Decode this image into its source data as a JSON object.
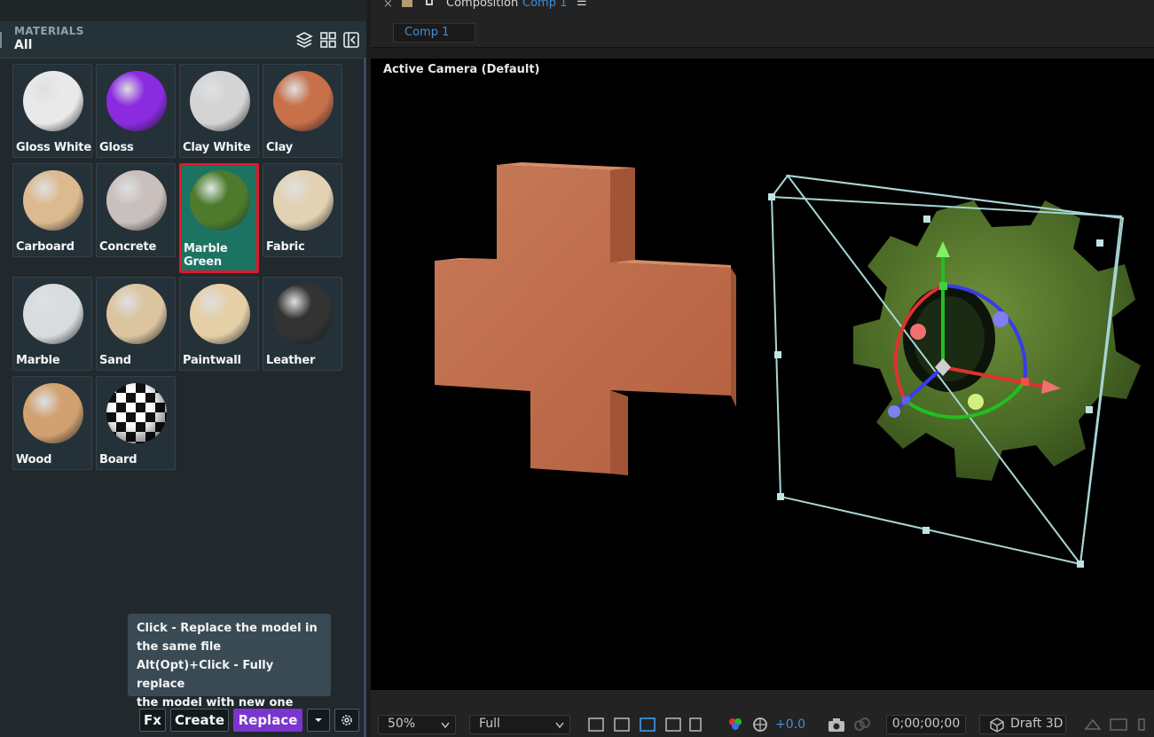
{
  "panel": {
    "title": "MATERIALS",
    "subtitle": "All",
    "icons": [
      "layers-icon",
      "grid-icon",
      "collapse-panel-icon"
    ]
  },
  "materials": [
    {
      "label": "Gloss White",
      "color": "#e9e9e9"
    },
    {
      "label": "Gloss",
      "color": "#8a2be2"
    },
    {
      "label": "Clay White",
      "color": "#d4d4d4"
    },
    {
      "label": "Clay",
      "color": "#c7704a"
    },
    {
      "label": "Carboard",
      "color": "#dcb98e"
    },
    {
      "label": "Concrete",
      "color": "#c9bfbd"
    },
    {
      "label": "Marble Green",
      "color": "#4e7a2c",
      "selected": true
    },
    {
      "label": "Fabric",
      "color": "#e2d2b3"
    },
    {
      "label": "Marble",
      "color": "#d9dcde"
    },
    {
      "label": "Sand",
      "color": "#dcc4a0"
    },
    {
      "label": "Paintwall",
      "color": "#e4cfa6"
    },
    {
      "label": "Leather",
      "color": "#333333"
    },
    {
      "label": "Wood",
      "color": "#d1a170"
    },
    {
      "label": "Board",
      "color": "#ffffff"
    }
  ],
  "tooltip": {
    "line1": "Click - Replace the model in",
    "line2": "the same file",
    "line3": "Alt(Opt)+Click - Fully replace",
    "line4": "the model with new one"
  },
  "actions": {
    "fx": "Fx",
    "create": "Create",
    "replace": "Replace"
  },
  "composition": {
    "close": "×",
    "label": "Composition",
    "name": "Comp 1",
    "menu": "☰",
    "tab": "Comp 1"
  },
  "viewer": {
    "camera_label": "Active Camera (Default)"
  },
  "toolbar": {
    "zoom": "50%",
    "resolution": "Full",
    "exposure": "+0.0",
    "timecode": "0;00;00;00",
    "renderer": "Draft 3D"
  },
  "colors": {
    "panel_bg": "#22292c",
    "selected_tile": "#1d7362",
    "selection_border": "#e0182a",
    "replace_button": "#7a35cf",
    "link_blue": "#3f8ed9"
  }
}
